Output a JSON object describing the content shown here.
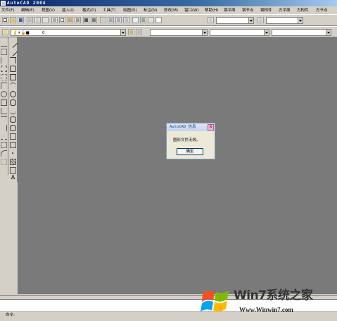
{
  "window": {
    "title": "AutoCAD 2004"
  },
  "menu": [
    {
      "label": "文件(F)"
    },
    {
      "label": "编辑(E)"
    },
    {
      "label": "视图(V)"
    },
    {
      "label": "插入(I)"
    },
    {
      "label": "格式(O)"
    },
    {
      "label": "工具(T)"
    },
    {
      "label": "绘图(D)"
    },
    {
      "label": "标注(N)"
    },
    {
      "label": "修改(M)"
    },
    {
      "label": "窗口(W)"
    },
    {
      "label": "帮助(H)"
    },
    {
      "label": "钢平面"
    },
    {
      "label": "钢节点"
    },
    {
      "label": "钢构件"
    },
    {
      "label": "方平面"
    },
    {
      "label": "方构件"
    },
    {
      "label": "方节点"
    }
  ],
  "layer_toolbar": {
    "layer_value": "0"
  },
  "dialog": {
    "title": "AutoCAD 信息",
    "message": "图形文件无效。",
    "ok_label": "确定",
    "close_glyph": "✕"
  },
  "command_line": {
    "prompt": "命令:"
  },
  "watermark": {
    "title": "Win7系统之家",
    "url": "Www.Winwin7.com"
  },
  "colors": {
    "drawing_area": "#7a7a7a",
    "chrome": "#d4d0c8",
    "titlebar_start": "#0a246a",
    "dialog_bg": "#ece9d8"
  }
}
